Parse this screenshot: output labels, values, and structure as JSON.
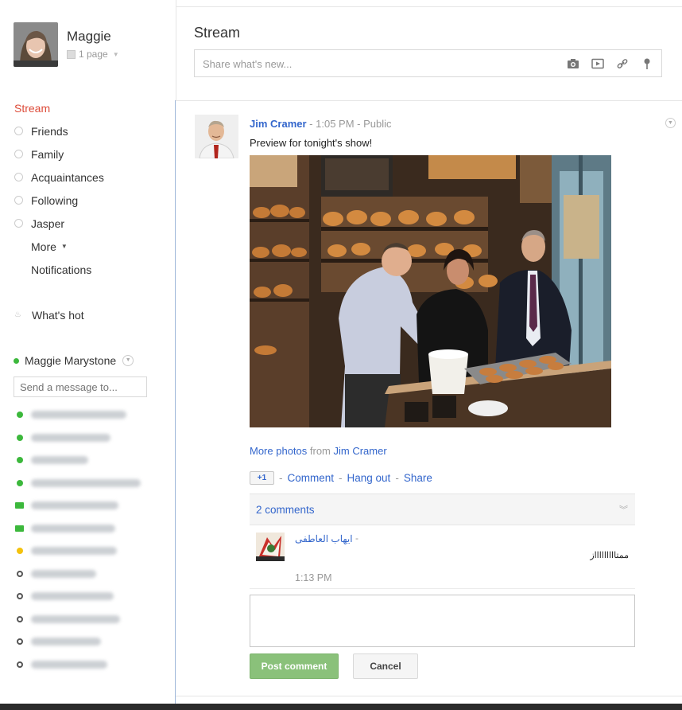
{
  "profile": {
    "name": "Maggie",
    "pages_label": "1 page"
  },
  "nav": {
    "stream_label": "Stream",
    "circles": [
      {
        "label": "Friends"
      },
      {
        "label": "Family"
      },
      {
        "label": "Acquaintances"
      },
      {
        "label": "Following"
      },
      {
        "label": "Jasper"
      }
    ],
    "more_label": "More",
    "notifications_label": "Notifications",
    "whats_hot_label": "What's hot"
  },
  "chat": {
    "user_name": "Maggie Marystone",
    "input_placeholder": "Send a message to...",
    "contacts": [
      {
        "status": "online"
      },
      {
        "status": "online"
      },
      {
        "status": "online"
      },
      {
        "status": "online"
      },
      {
        "status": "video"
      },
      {
        "status": "video"
      },
      {
        "status": "idle"
      },
      {
        "status": "offline"
      },
      {
        "status": "offline"
      },
      {
        "status": "offline"
      },
      {
        "status": "offline"
      },
      {
        "status": "offline"
      }
    ]
  },
  "stream": {
    "title": "Stream",
    "share_placeholder": "Share what's new..."
  },
  "post": {
    "author": "Jim Cramer",
    "time": "1:05 PM",
    "visibility": "Public",
    "text": "Preview for tonight's show!",
    "more_photos_label": "More photos",
    "from_label": "from",
    "more_photos_author": "Jim Cramer",
    "plus_one_label": "+1",
    "comment_label": "Comment",
    "hangout_label": "Hang out",
    "share_label": "Share"
  },
  "comments": {
    "count_label": "2 comments",
    "items": [
      {
        "author": "ايهاب العاطفى",
        "text": "ممتاااااااااز",
        "time": "1:13 PM"
      }
    ],
    "post_button": "Post comment",
    "cancel_button": "Cancel"
  },
  "colors": {
    "accent_red": "#dd4b39",
    "link_blue": "#3366cc",
    "online_green": "#3cb83c",
    "post_button_green": "#8ac17a"
  }
}
